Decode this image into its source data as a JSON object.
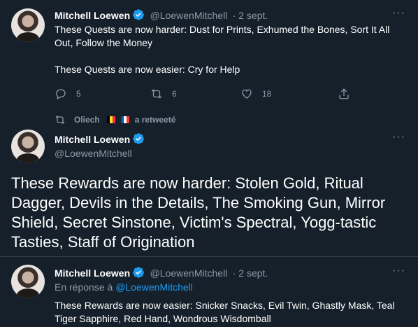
{
  "tweet1": {
    "name": "Mitchell Loewen",
    "handle": "@LoewenMitchell",
    "date": "· 2 sept.",
    "more": "···",
    "line1": "These Quests are now harder: Dust for Prints, Exhumed the Bones, Sort It All Out, Follow the Money",
    "line2": "These Quests are now easier: Cry for Help",
    "replies": "5",
    "retweets": "6",
    "likes": "18"
  },
  "retweet_banner": {
    "user": "Oliech",
    "suffix": "a retweeté"
  },
  "tweet2": {
    "name": "Mitchell Loewen",
    "handle": "@LoewenMitchell",
    "more": "···",
    "body": "These Rewards are now harder: Stolen Gold, Ritual Dagger, Devils in the Details, The Smoking Gun, Mirror Shield, Secret Sinstone, Victim's Spectral, Yogg-tastic Tasties, Staff of Origination"
  },
  "tweet3": {
    "name": "Mitchell Loewen",
    "handle": "@LoewenMitchell",
    "date": "· 2 sept.",
    "more": "···",
    "reply_prefix": "En réponse à",
    "reply_to": "@LoewenMitchell",
    "body": "These Rewards are now easier: Snicker Snacks, Evil Twin, Ghastly Mask, Teal Tiger Sapphire, Red Hand, Wondrous Wisdomball"
  },
  "colors": {
    "background": "#15202b",
    "secondary_text": "#8b98a5",
    "accent": "#1d9bf0",
    "divider": "#38444d"
  }
}
